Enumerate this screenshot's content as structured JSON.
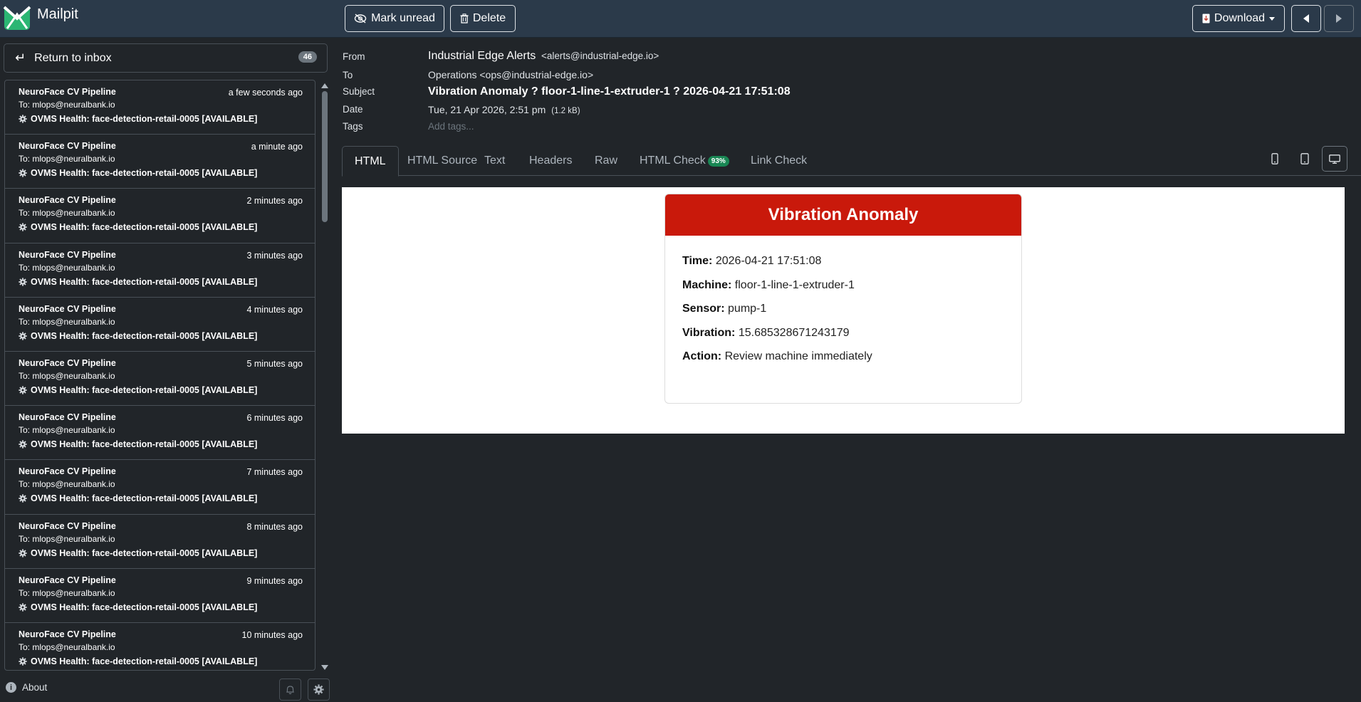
{
  "app": {
    "name": "Mailpit"
  },
  "toolbar": {
    "mark_unread": "Mark unread",
    "delete": "Delete",
    "download": "Download"
  },
  "sidebar": {
    "return_label": "Return to inbox",
    "count": "46",
    "about": "About",
    "messages": [
      {
        "from": "NeuroFace CV Pipeline",
        "time": "a few seconds ago",
        "to": "To: mlops@neuralbank.io",
        "subject": "OVMS Health: face-detection-retail-0005 [AVAILABLE]"
      },
      {
        "from": "NeuroFace CV Pipeline",
        "time": "a minute ago",
        "to": "To: mlops@neuralbank.io",
        "subject": "OVMS Health: face-detection-retail-0005 [AVAILABLE]"
      },
      {
        "from": "NeuroFace CV Pipeline",
        "time": "2 minutes ago",
        "to": "To: mlops@neuralbank.io",
        "subject": "OVMS Health: face-detection-retail-0005 [AVAILABLE]"
      },
      {
        "from": "NeuroFace CV Pipeline",
        "time": "3 minutes ago",
        "to": "To: mlops@neuralbank.io",
        "subject": "OVMS Health: face-detection-retail-0005 [AVAILABLE]"
      },
      {
        "from": "NeuroFace CV Pipeline",
        "time": "4 minutes ago",
        "to": "To: mlops@neuralbank.io",
        "subject": "OVMS Health: face-detection-retail-0005 [AVAILABLE]"
      },
      {
        "from": "NeuroFace CV Pipeline",
        "time": "5 minutes ago",
        "to": "To: mlops@neuralbank.io",
        "subject": "OVMS Health: face-detection-retail-0005 [AVAILABLE]"
      },
      {
        "from": "NeuroFace CV Pipeline",
        "time": "6 minutes ago",
        "to": "To: mlops@neuralbank.io",
        "subject": "OVMS Health: face-detection-retail-0005 [AVAILABLE]"
      },
      {
        "from": "NeuroFace CV Pipeline",
        "time": "7 minutes ago",
        "to": "To: mlops@neuralbank.io",
        "subject": "OVMS Health: face-detection-retail-0005 [AVAILABLE]"
      },
      {
        "from": "NeuroFace CV Pipeline",
        "time": "8 minutes ago",
        "to": "To: mlops@neuralbank.io",
        "subject": "OVMS Health: face-detection-retail-0005 [AVAILABLE]"
      },
      {
        "from": "NeuroFace CV Pipeline",
        "time": "9 minutes ago",
        "to": "To: mlops@neuralbank.io",
        "subject": "OVMS Health: face-detection-retail-0005 [AVAILABLE]"
      },
      {
        "from": "NeuroFace CV Pipeline",
        "time": "10 minutes ago",
        "to": "To: mlops@neuralbank.io",
        "subject": "OVMS Health: face-detection-retail-0005 [AVAILABLE]"
      }
    ]
  },
  "message": {
    "labels": {
      "from": "From",
      "to": "To",
      "subject": "Subject",
      "date": "Date",
      "tags": "Tags"
    },
    "from_name": "Industrial Edge Alerts",
    "from_addr": "<alerts@industrial-edge.io>",
    "to": "Operations <ops@industrial-edge.io>",
    "subject": "Vibration Anomaly ? floor-1-line-1-extruder-1 ? 2026-04-21 17:51:08",
    "date": "Tue, 21 Apr 2026, 2:51 pm",
    "size": "(1.2 kB)",
    "tags_placeholder": "Add tags..."
  },
  "tabs": {
    "html": "HTML",
    "html_source": "HTML Source",
    "text": "Text",
    "headers": "Headers",
    "raw": "Raw",
    "html_check": "HTML Check",
    "html_check_score": "93%",
    "link_check": "Link Check"
  },
  "email": {
    "title": "Vibration Anomaly",
    "brand_color": "#c9190b",
    "rows": [
      {
        "label": "Time:",
        "value": "2026-04-21 17:51:08"
      },
      {
        "label": "Machine:",
        "value": "floor-1-line-1-extruder-1"
      },
      {
        "label": "Sensor:",
        "value": "pump-1"
      },
      {
        "label": "Vibration:",
        "value": "15.685328671243179"
      },
      {
        "label": "Action:",
        "value": "Review machine immediately"
      }
    ]
  }
}
